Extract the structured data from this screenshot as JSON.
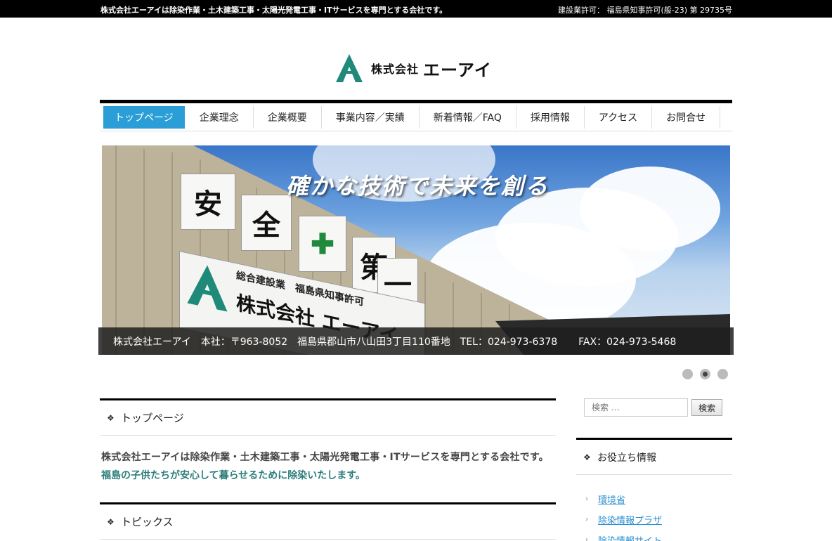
{
  "topbar": {
    "tagline": "株式会社エーアイは除染作業・土木建築工事・太陽光発電工事・ITサービスを専門とする会社です。",
    "license": "建設業許可： 福島県知事許可(般-23) 第 29735号"
  },
  "logo": {
    "small": "株式会社",
    "big": "エーアイ",
    "mark_letter": "A"
  },
  "nav": {
    "items": [
      {
        "label": "トップページ"
      },
      {
        "label": "企業理念"
      },
      {
        "label": "企業概要"
      },
      {
        "label": "事業内容／実績"
      },
      {
        "label": "新着情報／FAQ"
      },
      {
        "label": "採用情報"
      },
      {
        "label": "アクセス"
      },
      {
        "label": "お問合せ"
      }
    ]
  },
  "hero": {
    "slogan": "確かな技術で未来を創る",
    "signs": [
      "安",
      "全",
      "✚",
      "第",
      "一"
    ],
    "board_line1": "総合建設業　福島県知事許可",
    "board_line2": "株式会社 エーアイ",
    "caption": "株式会社エーアイ　本社：〒963-8052　福島県郡山市八山田3丁目110番地　TEL：024-973-6378",
    "caption_fax": "FAX：024-973-5468"
  },
  "slider": {
    "count": 3,
    "active_index": 1
  },
  "sections": {
    "top": {
      "bullet": "❖",
      "title": "トップページ"
    },
    "intro_line1": "株式会社エーアイは除染作業・土木建築工事・太陽光発電工事・ITサービスを専門とする会社です。",
    "intro_line2": "福島の子供たちが安心して暮らせるために除染いたします。",
    "topics": {
      "bullet": "❖",
      "title": "トピックス"
    }
  },
  "sidebar": {
    "search": {
      "placeholder": "検索 …",
      "button": "検索"
    },
    "useful": {
      "bullet": "❖",
      "title": "お役立ち情報",
      "links": [
        {
          "label": "環境省"
        },
        {
          "label": "除染情報プラザ"
        },
        {
          "label": "除染情報サイト"
        }
      ]
    }
  },
  "colors": {
    "accent": "#2b9ed8",
    "brand_green": "#1f8a7a",
    "intro_teal": "#2e7d7d",
    "link": "#2b8fd0"
  }
}
